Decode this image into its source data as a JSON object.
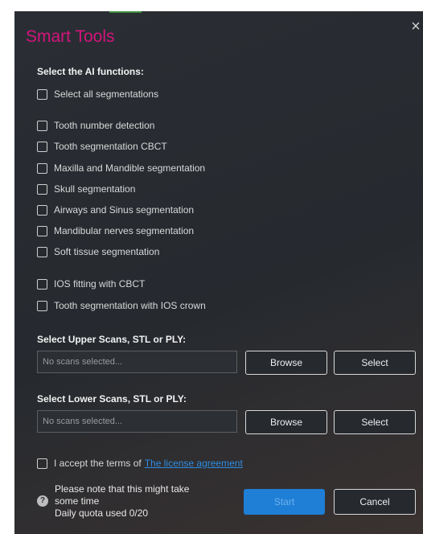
{
  "dialog": {
    "title": "Smart Tools",
    "close_glyph": "×",
    "ai_label": "Select the AI functions:",
    "select_all": "Select all segmentations",
    "segmentations": [
      "Tooth number detection",
      "Tooth segmentation CBCT",
      "Maxilla and Mandible segmentation",
      "Skull segmentation",
      "Airways and Sinus segmentation",
      "Mandibular nerves segmentation",
      "Soft tissue segmentation"
    ],
    "ios_options": [
      "IOS fitting with CBCT",
      "Tooth segmentation with IOS crown"
    ],
    "upper": {
      "label": "Select Upper Scans, STL or PLY:",
      "placeholder": "No scans selected...",
      "browse": "Browse",
      "select": "Select"
    },
    "lower": {
      "label": "Select Lower Scans, STL or PLY:",
      "placeholder": "No scans selected...",
      "browse": "Browse",
      "select": "Select"
    },
    "license": {
      "text": "I accept the terms of",
      "link": "The license agreement"
    },
    "note": {
      "line1": "Please note that this might take",
      "line2": "some time",
      "quota": "Daily quota used 0/20"
    },
    "start": "Start",
    "cancel": "Cancel"
  },
  "colors": {
    "title": "#d4147c",
    "accent_blue": "#1f7fd6",
    "link": "#2f8de4"
  }
}
